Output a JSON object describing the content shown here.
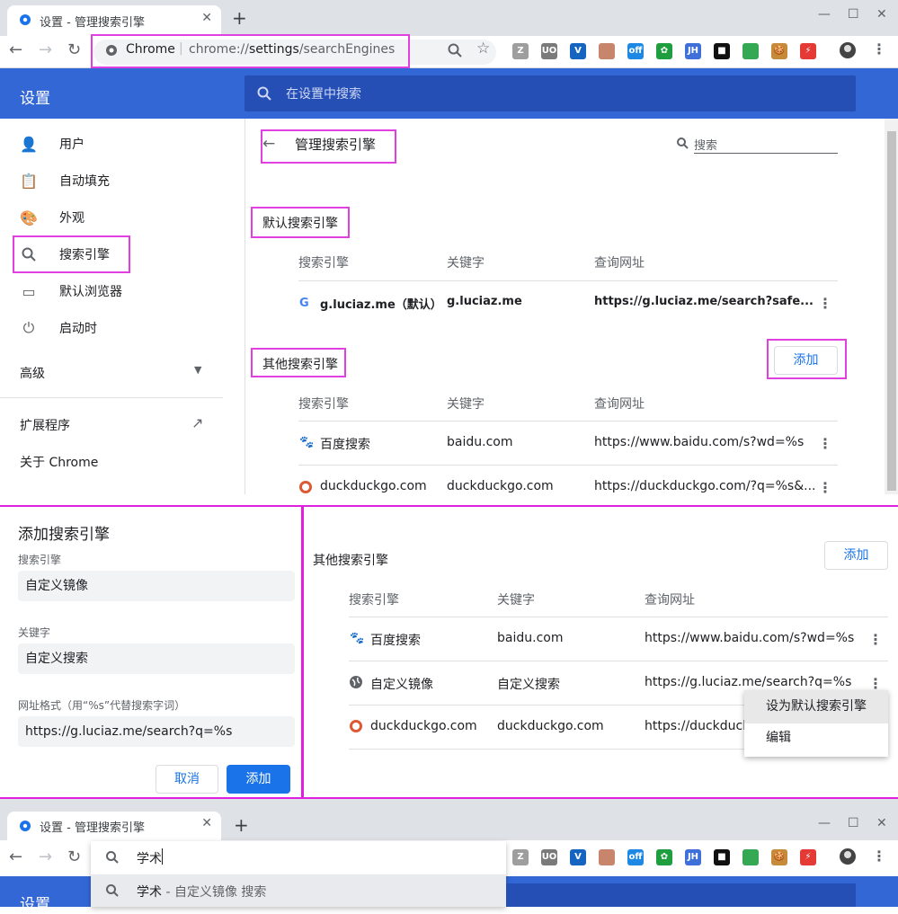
{
  "browser": {
    "tab_title": "设置 - 管理搜索引擎",
    "close": "✕",
    "new_tab": "+",
    "minimize": "—",
    "maximize": "☐",
    "close_window": "✕",
    "omni_scheme": "Chrome",
    "omni_url_pre": "chrome://",
    "omni_url_bold": "settings",
    "omni_url_post": "/searchEngines"
  },
  "extensions": [
    {
      "name": "z-icon",
      "label": "Z",
      "color": "#9e9e9e"
    },
    {
      "name": "ublock-icon",
      "label": "UO",
      "color": "#7a7a7a"
    },
    {
      "name": "v-icon",
      "label": "V",
      "color": "#1565c0"
    },
    {
      "name": "circle-icon",
      "label": "",
      "color": "#c7856b"
    },
    {
      "name": "off-ext-icon",
      "label": "off",
      "color": "#1e88e5"
    },
    {
      "name": "gear-green-icon",
      "label": "✿",
      "color": "#1e9e3e"
    },
    {
      "name": "jh-icon",
      "label": "JH",
      "color": "#3f6fd8"
    },
    {
      "name": "square-icon",
      "label": "■",
      "color": "#111111"
    },
    {
      "name": "chrome-color-icon",
      "label": "",
      "color": "#34a853"
    },
    {
      "name": "cookie-icon",
      "label": "🍪",
      "color": "#c68b3a"
    },
    {
      "name": "flash-icon",
      "label": "⚡",
      "color": "#e53935"
    }
  ],
  "settings": {
    "header_title": "设置",
    "search_placeholder": "在设置中搜索",
    "sidebar": [
      "用户",
      "自动填充",
      "外观",
      "搜索引擎",
      "默认浏览器",
      "启动时"
    ],
    "advanced": "高级",
    "extensions": "扩展程序",
    "about": "关于 Chrome",
    "page_title": "管理搜索引擎",
    "page_search": "搜索",
    "default_section": "默认搜索引擎",
    "other_section": "其他搜索引擎",
    "col_engine": "搜索引擎",
    "col_keyword": "关键字",
    "col_url": "查询网址",
    "default_engine": {
      "name": "g.luciaz.me（默认）",
      "keyword": "g.luciaz.me",
      "url": "https://g.luciaz.me/search?safe..."
    },
    "add": "添加",
    "other_engines": [
      {
        "name": "百度搜索",
        "keyword": "baidu.com",
        "url": "https://www.baidu.com/s?wd=%s"
      },
      {
        "name": "duckduckgo.com",
        "keyword": "duckduckgo.com",
        "url": "https://duckduckgo.com/?q=%s&..."
      }
    ]
  },
  "dialog": {
    "title": "添加搜索引擎",
    "engine_label": "搜索引擎",
    "engine_value": "自定义镜像",
    "keyword_label": "关键字",
    "keyword_value": "自定义搜索",
    "url_label": "网址格式（用“%s”代替搜索字词）",
    "url_value": "https://g.luciaz.me/search?q=%s",
    "cancel": "取消",
    "add": "添加"
  },
  "panel2": {
    "section": "其他搜索引擎",
    "add": "添加",
    "col_engine": "搜索引擎",
    "col_keyword": "关键字",
    "col_url": "查询网址",
    "rows": [
      {
        "name": "百度搜索",
        "keyword": "baidu.com",
        "url": "https://www.baidu.com/s?wd=%s"
      },
      {
        "name": "自定义镜像",
        "keyword": "自定义搜索",
        "url": "https://g.luciaz.me/search?q=%s"
      },
      {
        "name": "duckduckgo.com",
        "keyword": "duckduckgo.com",
        "url": "https://duckduckg"
      }
    ],
    "menu": [
      "设为默认搜索引擎",
      "编辑"
    ]
  },
  "bottom": {
    "tab_title": "设置 - 管理搜索引擎",
    "omni_query": "学术",
    "suggest_query": "学术",
    "suggest_suffix": " - 自定义镜像 搜索",
    "header_title": "设置"
  }
}
